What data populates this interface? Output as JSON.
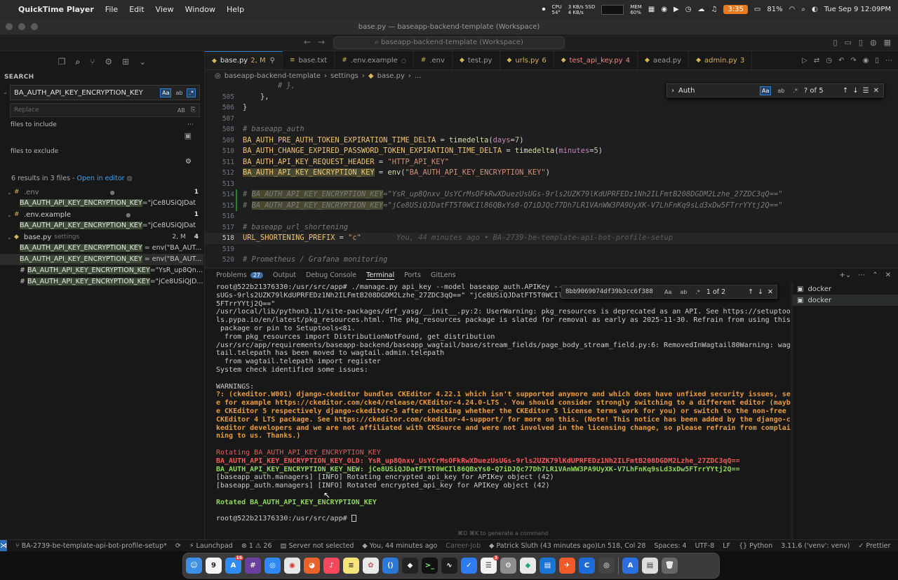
{
  "menubar": {
    "app_name": "QuickTime Player",
    "menus": [
      "File",
      "Edit",
      "View",
      "Window",
      "Help"
    ],
    "cpu": "CPU",
    "cpu_temp": "54°",
    "ssd_top": "3 KB/s SSD",
    "ssd_bottom": "4 KB/s",
    "mem": "MEM",
    "mem_pct": "60%",
    "timer": "3:35",
    "battery": "81%",
    "datetime": "Tue Sep 9  12:09PM"
  },
  "window": {
    "title": "base.py — baseapp-backend-template (Workspace)"
  },
  "toolbar": {
    "command_center": "baseapp-backend-template (Workspace)"
  },
  "sidebar": {
    "title": "SEARCH",
    "search_value": "BA_AUTH_API_KEY_ENCRYPTION_KEY",
    "opt_case": "Aa",
    "opt_word": "ab",
    "opt_regex": ".*",
    "replace_placeholder": "Replace",
    "replace_opt": "AB",
    "files_include_label": "files to include",
    "files_exclude_label": "files to exclude",
    "results_summary": "6 results in 3 files - ",
    "open_in_editor": "Open in editor",
    "results": [
      {
        "file": ".env",
        "dir": "",
        "status": "",
        "count": "1",
        "muted": true,
        "matches": [
          {
            "pre": "",
            "hit": "BA_AUTH_API_KEY_ENCRYPTION_KEY",
            "post": "=\"jCe8USiQJDat"
          }
        ]
      },
      {
        "file": ".env.example",
        "dir": "",
        "status": "",
        "count": "1",
        "muted": false,
        "matches": [
          {
            "pre": "",
            "hit": "BA_AUTH_API_KEY_ENCRYPTION_KEY",
            "post": "=\"jCe8USiQJDat"
          }
        ]
      },
      {
        "file": "base.py",
        "dir": "settings",
        "status": "2, M",
        "count": "4",
        "muted": false,
        "matches": [
          {
            "pre": "",
            "hit": "BA_AUTH_API_KEY_ENCRYPTION_KEY",
            "post": " = env(\"BA_AUT..."
          },
          {
            "pre": "",
            "hit": "BA_AUTH_API_KEY_ENCRYPTION_KEY",
            "post": " = env(\"BA_AUT..."
          },
          {
            "pre": "# ",
            "hit": "BA_AUTH_API_KEY_ENCRYPTION_KEY",
            "post": "=\"YsR_up8Qnx..."
          },
          {
            "pre": "# ",
            "hit": "BA_AUTH_API_KEY_ENCRYPTION_KEY",
            "post": "=\"jCe8USiQJD..."
          }
        ]
      }
    ]
  },
  "tabs": [
    {
      "label": "base.py",
      "status": "2, M",
      "active": true,
      "kind": "py"
    },
    {
      "label": "base.txt",
      "status": "",
      "active": false,
      "kind": "txt"
    },
    {
      "label": ".env.example",
      "status": "",
      "active": false,
      "kind": "env"
    },
    {
      "label": ".env",
      "status": "",
      "active": false,
      "kind": "env"
    },
    {
      "label": "test.py",
      "status": "",
      "active": false,
      "kind": "py"
    },
    {
      "label": "urls.py",
      "status": "6",
      "active": false,
      "kind": "py-warn"
    },
    {
      "label": "test_api_key.py",
      "status": "4",
      "active": false,
      "kind": "py-err"
    },
    {
      "label": "aead.py",
      "status": "",
      "active": false,
      "kind": "py"
    },
    {
      "label": "admin.py",
      "status": "3",
      "active": false,
      "kind": "py-warn"
    }
  ],
  "breadcrumb": [
    "baseapp-backend-template",
    "settings",
    "base.py",
    "..."
  ],
  "find_widget": {
    "value": "Auth",
    "case": "Aa",
    "word": "ab",
    "regex": ".*",
    "count": "? of 5"
  },
  "code_lines": [
    {
      "n": "",
      "parts": [
        [
          "c-comment",
          "        # },"
        ]
      ]
    },
    {
      "n": "505",
      "parts": [
        [
          "c-op",
          "    },"
        ]
      ]
    },
    {
      "n": "506",
      "parts": [
        [
          "c-op",
          "}"
        ]
      ]
    },
    {
      "n": "507",
      "parts": []
    },
    {
      "n": "508",
      "parts": [
        [
          "c-comment",
          "# baseapp_auth"
        ]
      ]
    },
    {
      "n": "509",
      "parts": [
        [
          "c-var",
          "BA_AUTH_PRE_AUTH_TOKEN_EXPIRATION_TIME_DELTA"
        ],
        [
          "c-op",
          " = "
        ],
        [
          "c-func",
          "timedelta"
        ],
        [
          "c-op",
          "("
        ],
        [
          "c-param",
          "days"
        ],
        [
          "c-op",
          "="
        ],
        [
          "c-num",
          "7"
        ],
        [
          "c-op",
          ")"
        ]
      ]
    },
    {
      "n": "510",
      "parts": [
        [
          "c-var",
          "BA_AUTH_CHANGE_EXPIRED_PASSWORD_TOKEN_EXPIRATION_TIME_DELTA"
        ],
        [
          "c-op",
          " = "
        ],
        [
          "c-func",
          "timedelta"
        ],
        [
          "c-op",
          "("
        ],
        [
          "c-param",
          "minutes"
        ],
        [
          "c-op",
          "="
        ],
        [
          "c-num",
          "5"
        ],
        [
          "c-op",
          ")"
        ]
      ]
    },
    {
      "n": "511",
      "parts": [
        [
          "c-var",
          "BA_AUTH_API_KEY_REQUEST_HEADER"
        ],
        [
          "c-op",
          " = "
        ],
        [
          "c-str",
          "\"HTTP_API_KEY\""
        ]
      ]
    },
    {
      "n": "512",
      "parts": [
        [
          "c-var c-hl",
          "BA_AUTH_API_KEY_ENCRYPTION_KEY"
        ],
        [
          "c-op",
          " = "
        ],
        [
          "c-func",
          "env"
        ],
        [
          "c-op",
          "("
        ],
        [
          "c-str",
          "\"BA_AUTH_API_KEY_ENCRYPTION_KEY\""
        ],
        [
          "c-op",
          ")"
        ]
      ]
    },
    {
      "n": "513",
      "parts": []
    },
    {
      "n": "514",
      "parts": [
        [
          "c-comment",
          "# "
        ],
        [
          "c-comment c-hl",
          "BA_AUTH_API_KEY_ENCRYPTION_KEY"
        ],
        [
          "c-comment",
          "=\"YsR_up8Qnxv_UsYCrMsOFkRwXDuezUsUGs-9rls2UZK79lKdUPRFEDz1Nh2ILFmtB208DGDM2Lzhe_27ZDC3qQ==\""
        ]
      ]
    },
    {
      "n": "515",
      "parts": [
        [
          "c-comment",
          "# "
        ],
        [
          "c-comment c-hl",
          "BA_AUTH_API_KEY_ENCRYPTION_KEY"
        ],
        [
          "c-comment",
          "=\"jCe8USiQJDatFT5T0WCIl86QBxYs0-Q7iDJQc77Dh7LR1VAnWW3PA9UyXK-V7LhFnKq9sLd3xDw5FTrrYYtj2Q==\""
        ]
      ]
    },
    {
      "n": "516",
      "parts": []
    },
    {
      "n": "517",
      "parts": [
        [
          "c-comment",
          "# baseapp_url_shortening"
        ]
      ]
    },
    {
      "n": "518",
      "parts": [
        [
          "c-var",
          "URL_SHORTENING_PREFIX"
        ],
        [
          "c-op",
          " = "
        ],
        [
          "c-str",
          "\"c\""
        ],
        [
          "c-blame",
          "        You, 44 minutes ago • BA-2739-be-template-api-bot-profile-setup"
        ]
      ]
    },
    {
      "n": "519",
      "parts": []
    },
    {
      "n": "520",
      "parts": [
        [
          "c-comment",
          "# Prometheus / Grafana monitoring"
        ]
      ]
    }
  ],
  "panel": {
    "tabs": [
      "Problems",
      "Output",
      "Debug Console",
      "Terminal",
      "Ports",
      "GitLens"
    ],
    "problems_count": "27",
    "active_tab": "Terminal"
  },
  "terminal_find": {
    "value": "8bb9069074df39b3cc6f388",
    "case": "Aa",
    "word": "ab",
    "regex": ".*",
    "count": "1 of 2"
  },
  "terminal": {
    "lines": [
      {
        "cls": "",
        "text": "root@522b21376330:/usr/src/app# ./manage.py api_key --model baseapp_auth.APIKey --r"
      },
      {
        "cls": "",
        "text": "sUGs-9rls2UZK79lKdUPRFEDz1Nh2ILFmtB208DGDM2Lzhe_27ZDC3qQ==\" \"jCe8USiQJDatFT5T0WCIl8"
      },
      {
        "cls": "",
        "text": "5FTrrYYtj2Q==\""
      },
      {
        "cls": "",
        "text": "/usr/local/lib/python3.11/site-packages/drf_yasg/__init__.py:2: UserWarning: pkg_resources is deprecated as an API. See https://setuptoo"
      },
      {
        "cls": "",
        "text": "ls.pypa.io/en/latest/pkg_resources.html. The pkg_resources package is slated for removal as early as 2025-11-30. Refrain from using this"
      },
      {
        "cls": "",
        "text": " package or pin to Setuptools<81."
      },
      {
        "cls": "",
        "text": "  from pkg_resources import DistributionNotFound, get_distribution"
      },
      {
        "cls": "",
        "text": "/usr/src/app/requirements/baseapp-backend/baseapp_wagtail/base/stream_fields/page_body_stream_field.py:6: RemovedInWagtail80Warning: wag"
      },
      {
        "cls": "",
        "text": "tail.telepath has been moved to wagtail.admin.telepath"
      },
      {
        "cls": "",
        "text": "  from wagtail.telepath import register"
      },
      {
        "cls": "",
        "text": "System check identified some issues:"
      },
      {
        "cls": "gap",
        "text": ""
      },
      {
        "cls": "",
        "text": "WARNINGS:"
      },
      {
        "cls": "t-warn",
        "text": "?: (ckeditor.W001) django-ckeditor bundles CKEditor 4.22.1 which isn't supported anymore and which does have unfixed security issues, se"
      },
      {
        "cls": "t-warn",
        "text": "e for example https://ckeditor.com/cke4/release/CKEditor-4.24.0-LTS . You should consider strongly switching to a different editor (mayb"
      },
      {
        "cls": "t-warn",
        "text": "e CKEditor 5 respectively django-ckeditor-5 after checking whether the CKEditor 5 license terms work for you) or switch to the non-free"
      },
      {
        "cls": "t-warn",
        "text": "CKEditor 4 LTS package. See https://ckeditor.com/ckeditor-4-support/ for more on this. (Note! This notice has been added by the django-c"
      },
      {
        "cls": "t-warn",
        "text": "keditor developers and we are not affiliated with CKSource and were not involved in the licensing change, so please refrain from complai"
      },
      {
        "cls": "t-warn",
        "text": "ning to us. Thanks.)"
      },
      {
        "cls": "gap",
        "text": ""
      },
      {
        "cls": "t-red",
        "text": "Rotating BA_AUTH_API_KEY_ENCRYPTION_KEY"
      },
      {
        "cls": "t-red-b",
        "text": "BA_AUTH_API_KEY_ENCRYPTION_KEY_OLD: YsR_up8Qnxv_UsYCrMsOFkRwXDuezUsUGs-9rls2UZK79lKdUPRFEDz1Nh2ILFmtB208DGDM2Lzhe_27ZDC3qQ=="
      },
      {
        "cls": "t-green-b",
        "text": "BA_AUTH_API_KEY_ENCRYPTION_KEY_NEW: jCe8USiQJDatFT5T0WCIl86QBxYs0-Q7iDJQc77Dh7LR1VAnWW3PA9UyXK-V7LhFnKq9sLd3xDw5FTrrYYtj2Q=="
      },
      {
        "cls": "",
        "text": "[baseapp_auth.managers] [INFO] Rotating encrypted_api_key for APIKey object (42)"
      },
      {
        "cls": "",
        "text": "[baseapp_auth.managers] [INFO] Rotated encrypted_api_key for APIKey object (42)"
      },
      {
        "cls": "gap",
        "text": ""
      },
      {
        "cls": "t-green-b",
        "text": "Rotated BA_AUTH_API_KEY_ENCRYPTION_KEY"
      },
      {
        "cls": "gap",
        "text": ""
      },
      {
        "cls": "",
        "text": "root@522b21376330:/usr/src/app# "
      }
    ],
    "hint": "⌘O ⌘K to generate a command"
  },
  "terminal_list": [
    "docker",
    "docker"
  ],
  "statusbar": {
    "branch": "BA-2739-be-template-api-bot-profile-setup*",
    "launchpad": "Launchpad",
    "problems": "⊗ 1 ⚠ 26",
    "server": "Server not selected",
    "blame": "You, 44 minutes ago",
    "career": "Career-Job",
    "author": "Patrick Sluth (43 minutes ago)",
    "position": "Ln 518, Col 28",
    "spaces": "Spaces: 4",
    "encoding": "UTF-8",
    "eol": "LF",
    "language": "Python",
    "interpreter": "3.11.6 ('venv': venv)",
    "prettier": "Prettier"
  },
  "dock": {
    "calendar_day": "9",
    "badge_appstore": "16",
    "badge_reminders": "3"
  },
  "colors": {
    "accent": "#2d7fd3",
    "warn": "#e89b3f",
    "error_red": "#f45858",
    "success_green": "#8fd659"
  }
}
